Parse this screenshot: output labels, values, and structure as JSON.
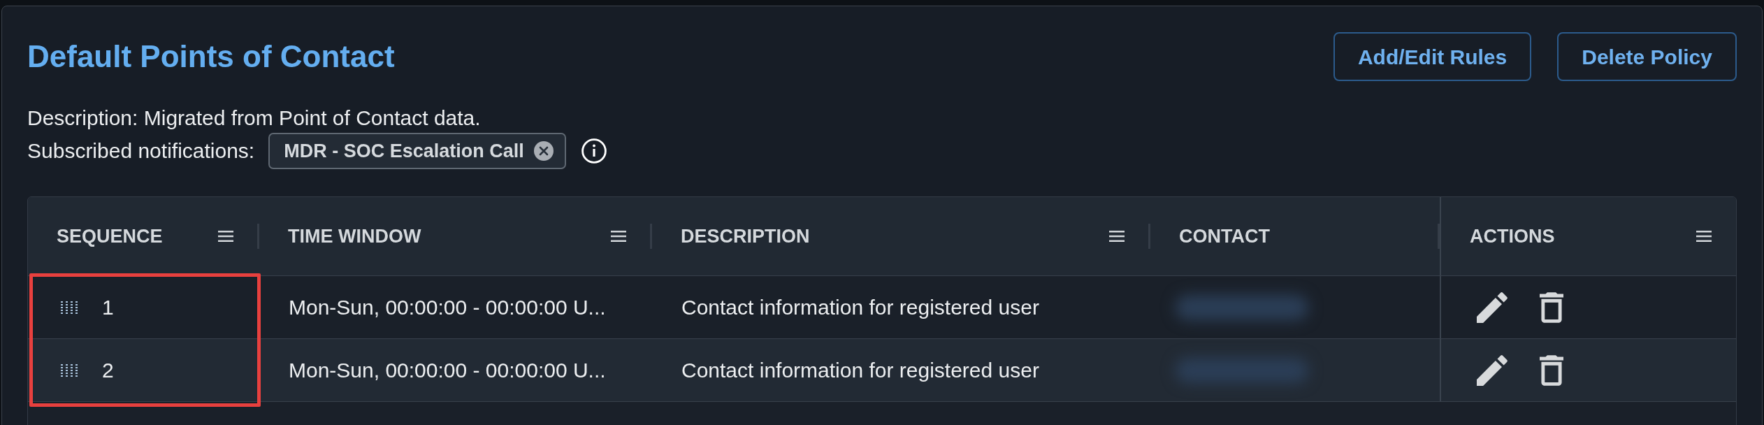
{
  "header": {
    "title": "Default Points of Contact",
    "buttons": [
      {
        "label": "Add/Edit Rules"
      },
      {
        "label": "Delete Policy"
      }
    ]
  },
  "description": "Description: Migrated from Point of Contact data.",
  "subscribed_notifications": {
    "label": "Subscribed notifications:",
    "chips": [
      {
        "label": "MDR - SOC Escalation Call",
        "removable": true
      }
    ]
  },
  "table": {
    "columns": [
      {
        "label": "SEQUENCE",
        "menu": true,
        "highlighted": true
      },
      {
        "label": "TIME WINDOW",
        "menu": true,
        "highlighted": false
      },
      {
        "label": "DESCRIPTION",
        "menu": true,
        "highlighted": false
      },
      {
        "label": "CONTACT",
        "menu": false,
        "highlighted": false
      },
      {
        "label": "ACTIONS",
        "menu": true,
        "highlighted": false
      }
    ],
    "rows": [
      {
        "sequence": "1",
        "time_window": "Mon-Sun, 00:00:00 - 00:00:00 U...",
        "description": "Contact information for registered user",
        "contact_blurred": true
      },
      {
        "sequence": "2",
        "time_window": "Mon-Sun, 00:00:00 - 00:00:00 U...",
        "description": "Contact information for registered user",
        "contact_blurred": true
      }
    ]
  }
}
